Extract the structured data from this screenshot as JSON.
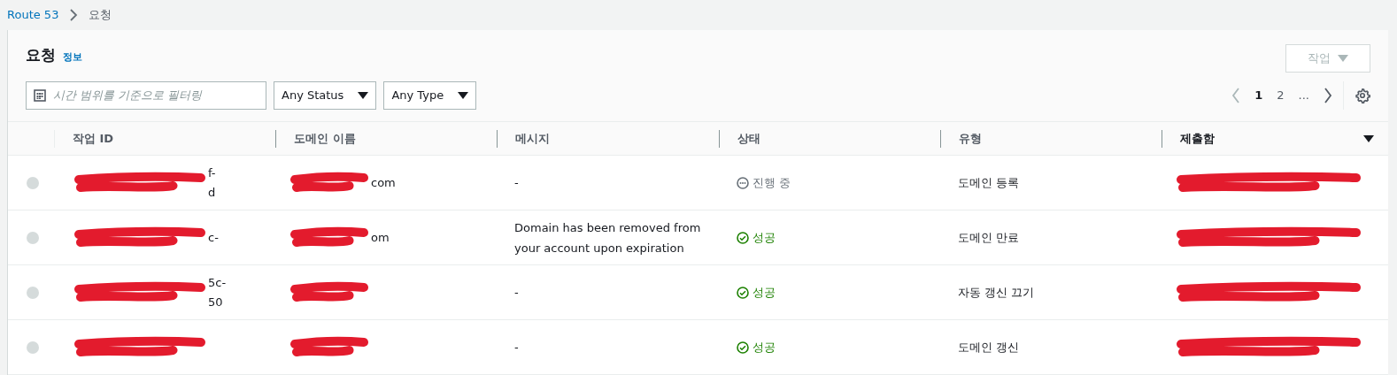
{
  "breadcrumb": [
    {
      "label": "Route 53",
      "kind": "link"
    },
    {
      "label": "요청",
      "kind": "current"
    }
  ],
  "header": {
    "title": "요청",
    "info": "정보",
    "actions": {
      "label": "작업",
      "disabled": true
    }
  },
  "filters": {
    "search": {
      "placeholder": "시간 범위를 기준으로 필터링"
    },
    "dropdowns": [
      "Any Status",
      "Any Type"
    ]
  },
  "pagination": {
    "pages": [
      {
        "label": "1",
        "selected": true
      },
      {
        "label": "2",
        "selected": false
      },
      {
        "label": "...",
        "selected": false
      }
    ],
    "prev_disabled": true,
    "next_disabled": false
  },
  "table": {
    "columns": [
      {
        "label": "작업 ID",
        "sorted": false
      },
      {
        "label": "도메인 이름",
        "sorted": false
      },
      {
        "label": "메시지",
        "sorted": false
      },
      {
        "label": "상태",
        "sorted": false
      },
      {
        "label": "유형",
        "sorted": false
      },
      {
        "label": "제출함",
        "sorted": true
      }
    ],
    "rows": [
      {
        "selected": false,
        "id": {
          "redacted": true,
          "visible": [
            "f-",
            "d"
          ]
        },
        "domain": {
          "redacted": true,
          "visible": [
            "com"
          ]
        },
        "message": "-",
        "status": {
          "kind": "in_progress",
          "label": "진행 중"
        },
        "type": "도메인 등록",
        "submitted": {
          "redacted": true
        }
      },
      {
        "selected": false,
        "id": {
          "redacted": true,
          "visible": [
            "c-"
          ]
        },
        "domain": {
          "redacted": true,
          "visible": [
            "om"
          ]
        },
        "message": "Domain has been removed from your account upon expiration",
        "status": {
          "kind": "success",
          "label": "성공"
        },
        "type": "도메인 만료",
        "submitted": {
          "redacted": true
        }
      },
      {
        "selected": false,
        "id": {
          "redacted": true,
          "visible": [
            "5c-",
            "50"
          ]
        },
        "domain": {
          "redacted": true
        },
        "message": "-",
        "status": {
          "kind": "success",
          "label": "성공"
        },
        "type": "자동 갱신 끄기",
        "submitted": {
          "redacted": true
        }
      },
      {
        "selected": false,
        "id": {
          "redacted": true
        },
        "domain": {
          "redacted": true
        },
        "message": "-",
        "status": {
          "kind": "success",
          "label": "성공"
        },
        "type": "도메인 갱신",
        "submitted": {
          "redacted": true
        }
      }
    ]
  }
}
